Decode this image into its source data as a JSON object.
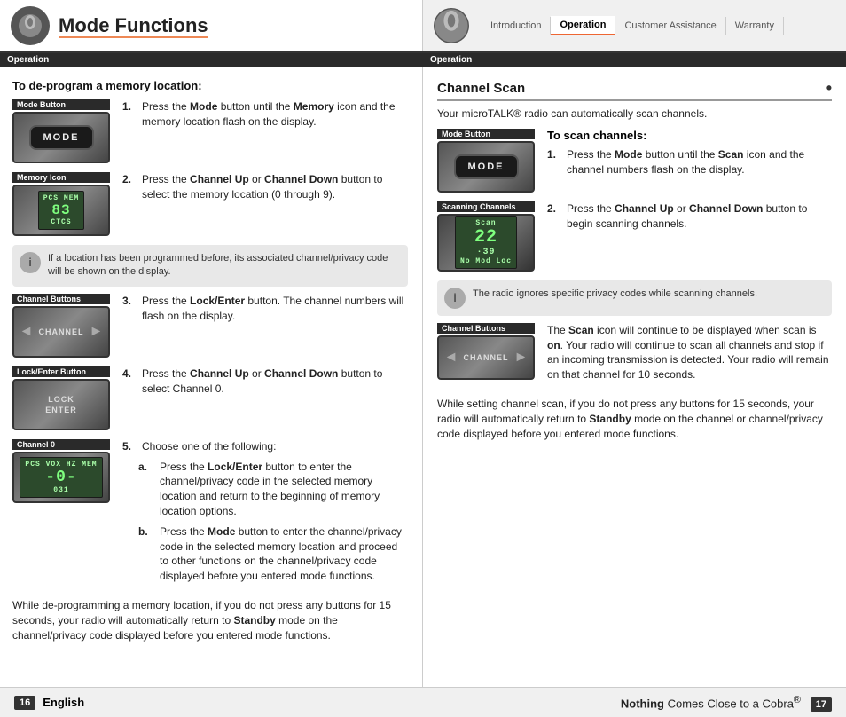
{
  "header": {
    "left": {
      "icon_label": "Cobra icon left",
      "title": "Mode Functions",
      "section_label": "Operation"
    },
    "right": {
      "icon_label": "Cobra icon right",
      "nav_items": [
        "Introduction",
        "Operation",
        "Customer Assistance",
        "Warranty"
      ],
      "active_nav": "Operation"
    }
  },
  "left_panel": {
    "de_program_title": "To de-program a memory location:",
    "images": {
      "mode_button_label": "Mode Button",
      "memory_icon_label": "Memory Icon",
      "channel_buttons_label": "Channel Buttons",
      "lock_enter_label": "Lock/Enter Button",
      "channel_0_label": "Channel 0"
    },
    "steps": [
      {
        "num": "1.",
        "text_before": "Press the ",
        "bold": "Mode",
        "text_after": " button until the ",
        "bold2": "Memory",
        "text_after2": " icon and the memory location flash on the display."
      },
      {
        "num": "2.",
        "text_before": "Press the ",
        "bold": "Channel Up",
        "text_mid": " or ",
        "bold2": "Channel Down",
        "text_after": " button to select the memory location (0 through 9)."
      },
      {
        "num": "3.",
        "text_before": "Press the ",
        "bold": "Lock/Enter",
        "text_after": " button. The channel numbers will flash on the display."
      },
      {
        "num": "4.",
        "text_before": "Press the ",
        "bold": "Channel Up",
        "text_mid": " or ",
        "bold2": "Channel Down",
        "text_after": " button to select Channel 0."
      },
      {
        "num": "5.",
        "text_after": "Choose one of the following:"
      }
    ],
    "sub_steps": [
      {
        "letter": "a.",
        "text_before": "Press the ",
        "bold": "Lock/Enter",
        "text_after": " button to enter the channel/privacy code in the selected memory location and return to the beginning of memory location options."
      },
      {
        "letter": "b.",
        "text_before": "Press the ",
        "bold": "Mode",
        "text_after": " button to enter the channel/privacy code in the selected memory location and proceed to other functions on the channel/privacy code displayed before you entered mode functions."
      }
    ],
    "note_box": {
      "text": "If a location has been programmed before, its associated channel/privacy code will be shown on the display."
    },
    "closing_para": "While de-programming a memory location, if you do not press any buttons for 15 seconds, your radio will automatically return to Standby mode on the channel/privacy code displayed before you entered mode functions.",
    "closing_para_bold": "Standby"
  },
  "right_panel": {
    "channel_scan_title": "Channel Scan",
    "intro": "Your microTALK® radio can automatically scan channels.",
    "images": {
      "mode_button_label": "Mode Button",
      "scanning_channels_label": "Scanning Channels",
      "channel_buttons_label": "Channel Buttons"
    },
    "to_scan_title": "To scan channels:",
    "steps": [
      {
        "num": "1.",
        "text_before": "Press the ",
        "bold": "Mode",
        "text_after": " button until the ",
        "bold2": "Scan",
        "text_after2": " icon and the channel numbers flash on the display."
      },
      {
        "num": "2.",
        "text_before": "Press the ",
        "bold": "Channel Up",
        "text_mid": " or ",
        "bold2": "Channel Down",
        "text_after": " button to begin scanning channels."
      }
    ],
    "note_box": {
      "text": "The radio ignores specific privacy codes while scanning channels."
    },
    "scan_description_1": "The ",
    "scan_description_bold": "Scan",
    "scan_description_2": " icon will continue to be displayed when scan is ",
    "scan_description_bold2": "on",
    "scan_description_3": ". Your radio will continue to scan all channels and stop if an incoming transmission is detected. Your radio will remain on that channel for 10 seconds.",
    "scan_description_para2": "While setting channel scan, if you do not press any buttons for 15 seconds, your radio will automatically return to Standby mode on the channel or channel/privacy code displayed before you entered mode functions.",
    "scan_description_para2_bold": "Standby"
  },
  "footer": {
    "page_num": "16",
    "language": "English",
    "right_text": "Nothing",
    "right_text2": " Comes Close to a Cobra",
    "right_trademark": "®",
    "page_num_right": "17"
  }
}
